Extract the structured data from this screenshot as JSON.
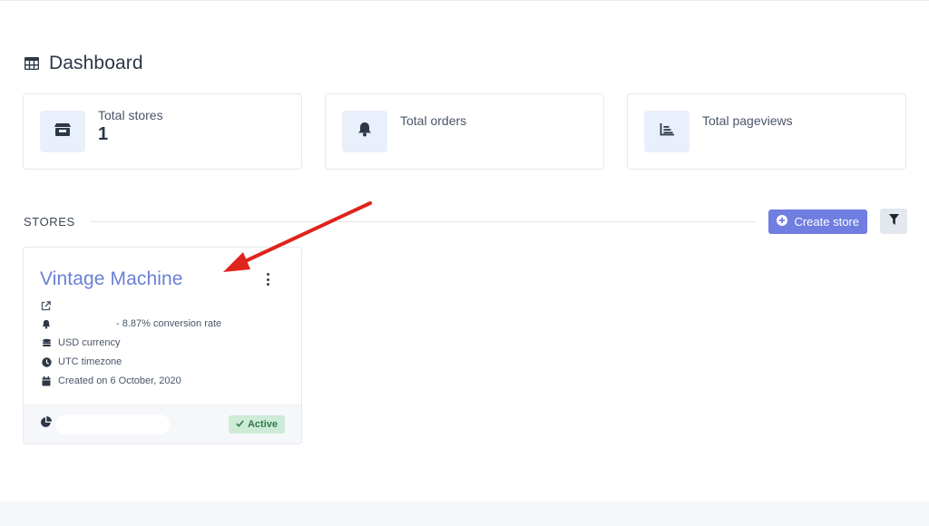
{
  "header": {
    "title": "Dashboard",
    "icon": "table-grid-icon"
  },
  "stats": [
    {
      "label": "Total stores",
      "value": "1",
      "icon": "store-icon"
    },
    {
      "label": "Total orders",
      "value": "",
      "icon": "bell-icon"
    },
    {
      "label": "Total pageviews",
      "value": "",
      "icon": "chart-area-icon"
    }
  ],
  "stores_section": {
    "label": "STORES",
    "create_label": "Create store",
    "filter_icon": "filter-icon"
  },
  "store_card": {
    "name": "Vintage Machine",
    "conversion": "- 8.87% conversion rate",
    "currency": "USD currency",
    "timezone": "UTC timezone",
    "created": "Created on 6 October, 2020",
    "status": "Active"
  },
  "colors": {
    "accent": "#6f7ee0",
    "store_name": "#6a7fd6",
    "annotation_arrow": "#e0231c",
    "badge_bg": "#cdebd6",
    "badge_text": "#2f7a4a"
  }
}
